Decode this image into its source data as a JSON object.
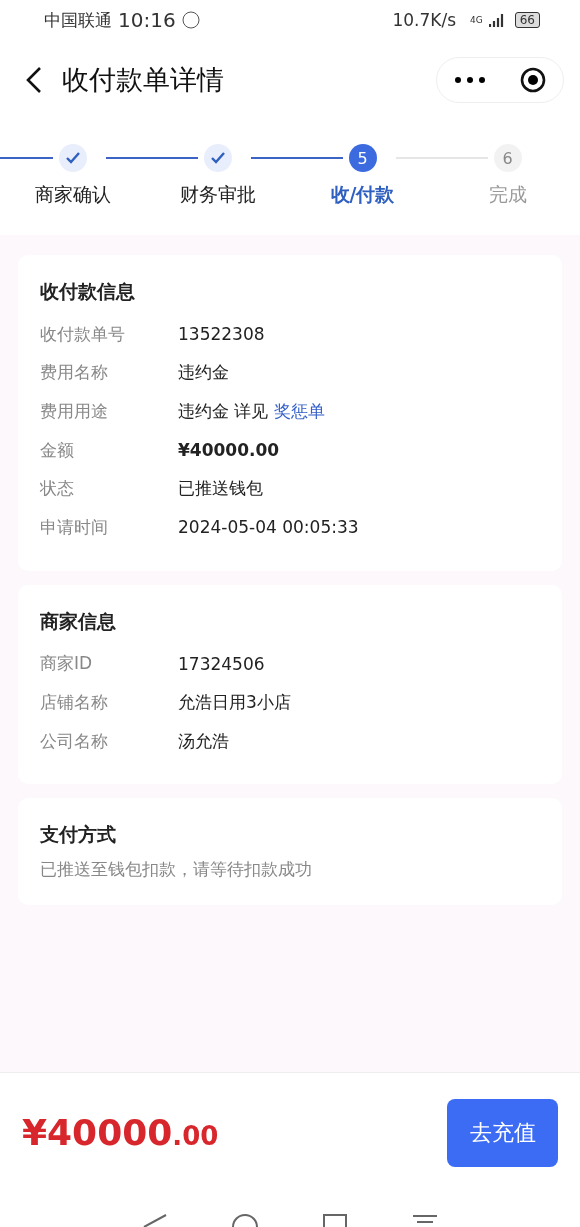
{
  "status_bar": {
    "carrier": "中国联通",
    "time": "10:16",
    "speed": "10.7K/s",
    "network": "4G",
    "battery": "66"
  },
  "header": {
    "title": "收付款单详情"
  },
  "steps": [
    {
      "label": "商家确认",
      "kind": "done"
    },
    {
      "label": "财务审批",
      "kind": "done"
    },
    {
      "label": "收/付款",
      "kind": "current",
      "number": "5"
    },
    {
      "label": "完成",
      "kind": "todo",
      "number": "6"
    }
  ],
  "sections": [
    {
      "title": "收付款信息",
      "rows": [
        {
          "label": "收付款单号",
          "value": "13522308"
        },
        {
          "label": "费用名称",
          "value": "违约金"
        },
        {
          "label": "费用用途",
          "value": "违约金 详见",
          "link": "奖惩单"
        },
        {
          "label": "金额",
          "value": "¥40000.00",
          "bold": true
        },
        {
          "label": "状态",
          "value": "已推送钱包"
        },
        {
          "label": "申请时间",
          "value": "2024-05-04 00:05:33"
        }
      ]
    },
    {
      "title": "商家信息",
      "rows": [
        {
          "label": "商家ID",
          "value": "17324506"
        },
        {
          "label": "店铺名称",
          "value": "允浩日用3小店"
        },
        {
          "label": "公司名称",
          "value": "汤允浩"
        }
      ]
    },
    {
      "title": "支付方式",
      "note": "已推送至钱包扣款，请等待扣款成功"
    }
  ],
  "footer": {
    "amount_main": "¥40000",
    "amount_decimal": ".00",
    "button": "去充值"
  }
}
